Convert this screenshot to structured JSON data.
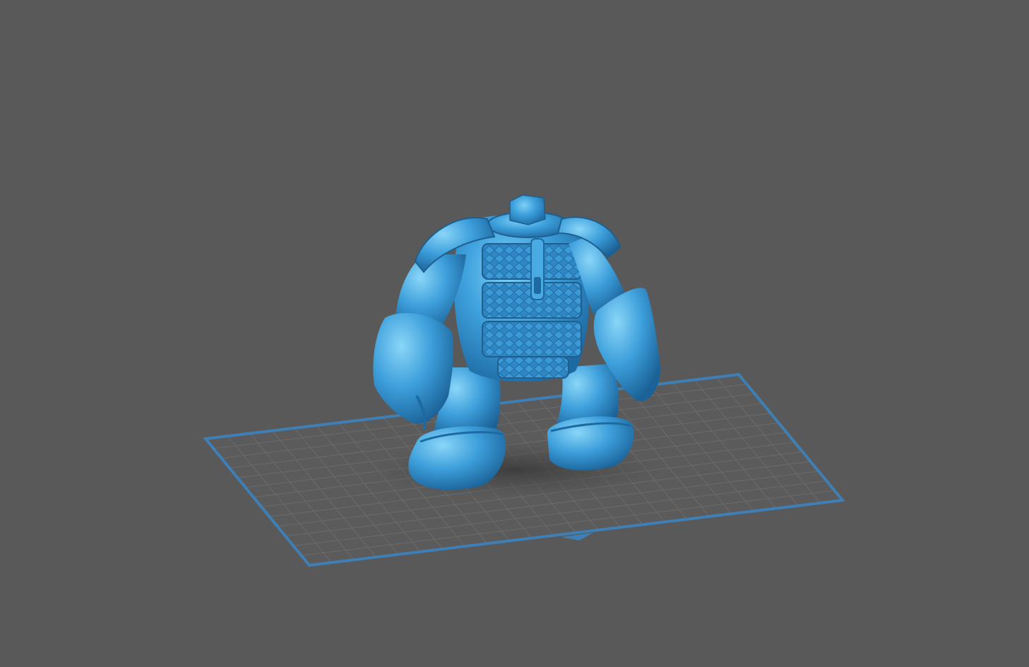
{
  "viewport": {
    "background": "#595959"
  },
  "build_plate": {
    "border_color": "#3e7fb5",
    "grid_color": "#6b6b6b",
    "surface_color": "#5a5a5a",
    "grid_columns": 24,
    "grid_rows": 13
  },
  "model": {
    "body_color": "#3a9ad6",
    "highlight_color": "#6cc4f2",
    "shadow_color": "#1f5f8f",
    "icon": "3d-model-figure"
  }
}
